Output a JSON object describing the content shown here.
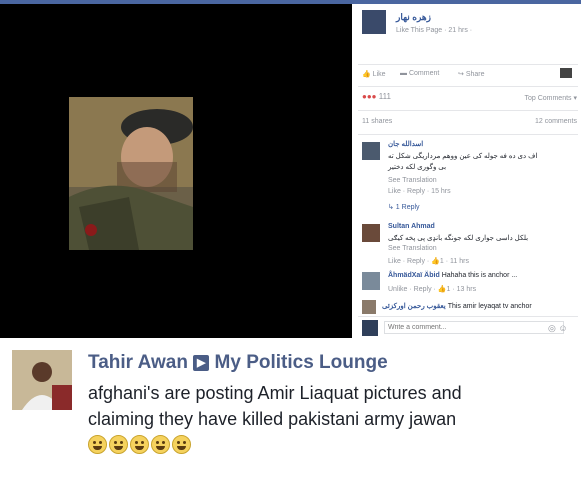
{
  "post": {
    "page_name": "زهره نهار",
    "meta": "Like This Page · 21 hrs ·",
    "actions": {
      "like": "Like",
      "comment": "Comment",
      "share": "Share"
    },
    "reactions_count": "111",
    "sort_label": "Top Comments ▾",
    "shares": "11 shares",
    "comments_count": "12 comments"
  },
  "comments": [
    {
      "author": "اسدالله جان",
      "text_line1": "اف دی ده فه جوله کی عین ووهم مرداریگی شکل ته",
      "text_line2": "بی وگوری لکه دختیر",
      "see_translation": "See Translation",
      "meta": "Like · Reply · 15 hrs",
      "reply_link": "↳ 1 Reply"
    },
    {
      "author": "Sultan Ahmad",
      "text_line1": "بلکل داسی جواری لکه جونگه بانډی پی پخه کیګی",
      "see_translation": "See Translation",
      "meta": "Like · Reply · 👍1 · 11 hrs"
    },
    {
      "author": "ÅhmädXaï Äbid",
      "text": "Hahaha this is anchor ...",
      "meta": "Unlike · Reply · 👍1 · 13 hrs"
    },
    {
      "author": "یعقوب رحمن اورکزئی",
      "text": "This amir leyaqat tv anchor"
    }
  ],
  "comment_box": {
    "placeholder": "Write a comment..."
  },
  "share_post": {
    "user_name": "Tahir Awan",
    "group_name": "My Politics Lounge",
    "text_line1": "afghani's are posting Amir Liaquat pictures and",
    "text_line2": "claiming they have killed pakistani army jawan"
  },
  "colors": {
    "facebook_blue": "#365899",
    "topbar": "#4a66a0",
    "viewer_bg": "#000000"
  }
}
